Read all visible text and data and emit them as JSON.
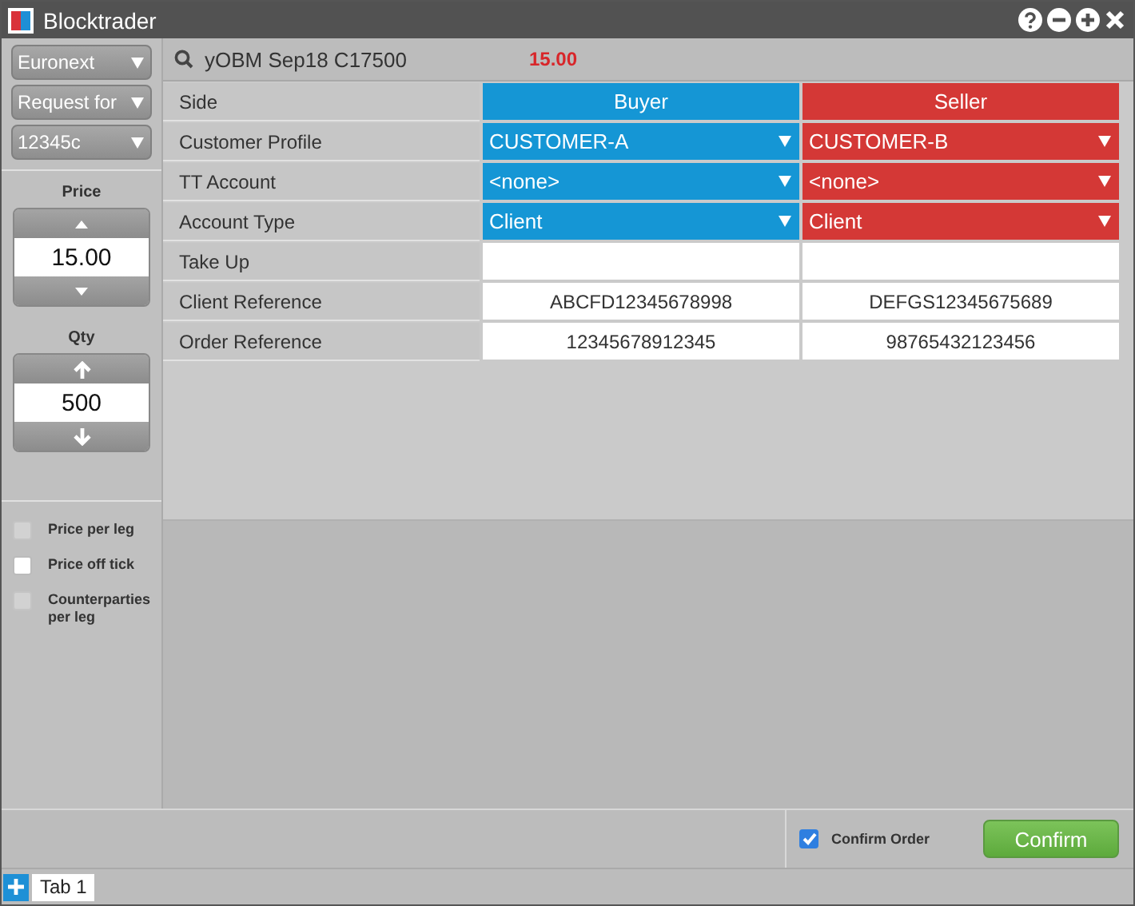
{
  "window": {
    "title": "Blocktrader"
  },
  "sidebar": {
    "dropdowns": [
      {
        "value": "Euronext"
      },
      {
        "value": "Request for"
      },
      {
        "value": "12345c"
      }
    ],
    "spinners": [
      {
        "label": "Price",
        "value": "15.00",
        "kind": "triangle"
      },
      {
        "label": "Qty",
        "value": "500",
        "kind": "arrow"
      }
    ],
    "options": [
      {
        "label": "Price per leg",
        "checked": false,
        "disabled": true
      },
      {
        "label": "Price off tick",
        "checked": false,
        "disabled": false
      },
      {
        "label": "Counterparties per leg",
        "checked": false,
        "disabled": true
      }
    ]
  },
  "instrument": {
    "name": "yOBM Sep18 C17500",
    "price": "15.00"
  },
  "grid": {
    "side_label": "Side",
    "columns": [
      {
        "label": "Buyer",
        "color": "#1596d5"
      },
      {
        "label": "Seller",
        "color": "#d43836"
      }
    ],
    "rows": [
      {
        "label": "Customer Profile",
        "kind": "dropdown",
        "cells": [
          "CUSTOMER-A",
          "CUSTOMER-B"
        ]
      },
      {
        "label": "TT Account",
        "kind": "dropdown",
        "cells": [
          "<none>",
          "<none>"
        ]
      },
      {
        "label": "Account Type",
        "kind": "dropdown",
        "cells": [
          "Client",
          "Client"
        ]
      },
      {
        "label": "Take Up",
        "kind": "input"
      },
      {
        "label": "Client Reference",
        "kind": "text",
        "cells": [
          "ABCFD12345678998",
          "DEFGS12345675689"
        ]
      },
      {
        "label": "Order Reference",
        "kind": "text",
        "cells": [
          "12345678912345",
          "98765432123456"
        ]
      }
    ]
  },
  "footer": {
    "confirm_order": {
      "label": "Confirm Order",
      "checked": true
    },
    "confirm_button": "Confirm"
  },
  "tabs": [
    {
      "label": "Tab 1",
      "selected": true
    }
  ]
}
